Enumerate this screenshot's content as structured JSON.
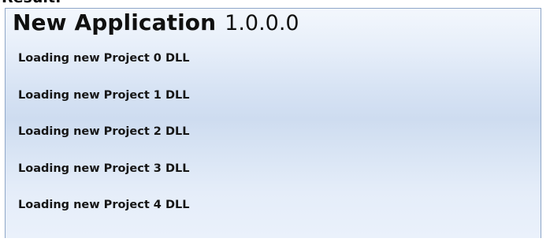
{
  "caption": "Result:",
  "header": {
    "app_name": "New Application",
    "version": "1.0.0.0"
  },
  "loading_items": [
    "Loading new Project 0 DLL",
    "Loading new Project 1 DLL",
    "Loading new Project 2 DLL",
    "Loading new Project 3 DLL",
    "Loading new Project 4 DLL"
  ]
}
